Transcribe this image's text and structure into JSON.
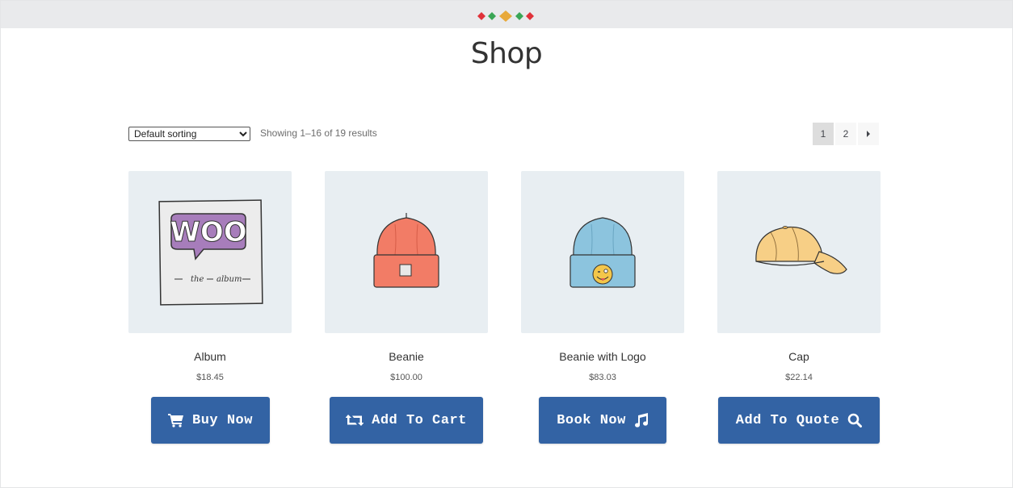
{
  "header": {
    "logo_icon": "diamonds-logo-icon",
    "logo_colors": [
      "#e0323a",
      "#3aa655",
      "#e8a93a",
      "#3aa655",
      "#e0323a"
    ]
  },
  "page": {
    "title": "Shop"
  },
  "toolbar": {
    "sort_selected": "Default sorting",
    "sort_options": [
      "Default sorting"
    ],
    "result_count": "Showing 1–16 of 19 results"
  },
  "pagination": {
    "pages": [
      "1",
      "2"
    ],
    "current": "1",
    "next_icon": "caret-right-icon"
  },
  "products": [
    {
      "name": "Album",
      "price": "$18.45",
      "button": "Buy Now",
      "button_icon": "shopping-cart-icon",
      "image": "album-cover-image"
    },
    {
      "name": "Beanie",
      "price": "$100.00",
      "button": "Add To Cart",
      "button_icon": "retweet-icon",
      "image": "orange-beanie-image"
    },
    {
      "name": "Beanie with Logo",
      "price": "$83.03",
      "button": "Book Now",
      "button_icon": "music-note-icon",
      "image": "blue-beanie-logo-image"
    },
    {
      "name": "Cap",
      "price": "$22.14",
      "button": "Add To Quote",
      "button_icon": "search-icon",
      "image": "cap-image"
    }
  ],
  "colors": {
    "button_bg": "#3363a4",
    "image_bg": "#e8eef2"
  }
}
